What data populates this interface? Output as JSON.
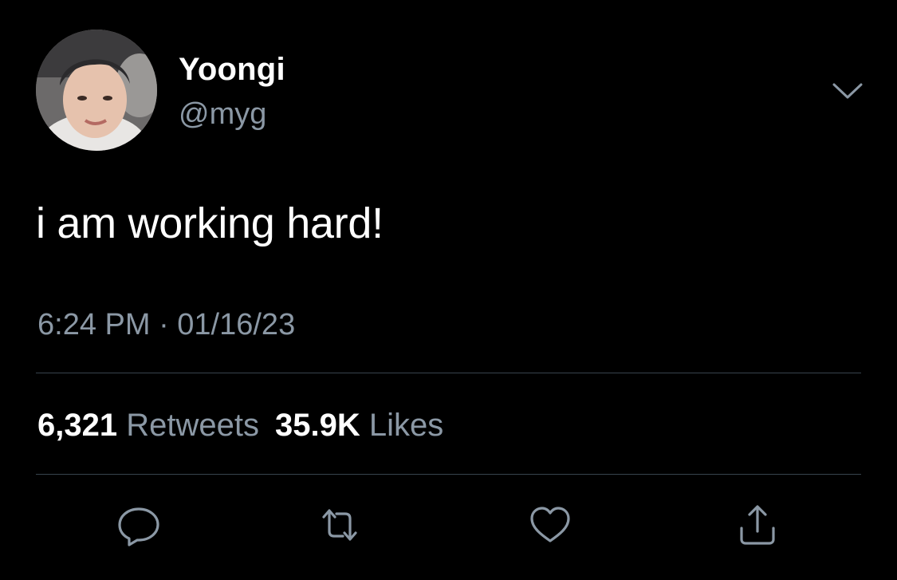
{
  "user": {
    "display_name": "Yoongi",
    "handle": "@myg"
  },
  "tweet": {
    "text": "i am working hard!",
    "timestamp": "6:24 PM · 01/16/23"
  },
  "stats": {
    "retweets_count": "6,321",
    "retweets_label": "Retweets",
    "likes_count": "35.9K",
    "likes_label": "Likes"
  },
  "icons": {
    "more": "chevron-down-icon",
    "reply": "reply-icon",
    "retweet": "retweet-icon",
    "like": "heart-icon",
    "share": "share-icon"
  },
  "colors": {
    "background": "#000000",
    "primary_text": "#ffffff",
    "secondary_text": "#8b98a5",
    "divider": "#38444d"
  }
}
